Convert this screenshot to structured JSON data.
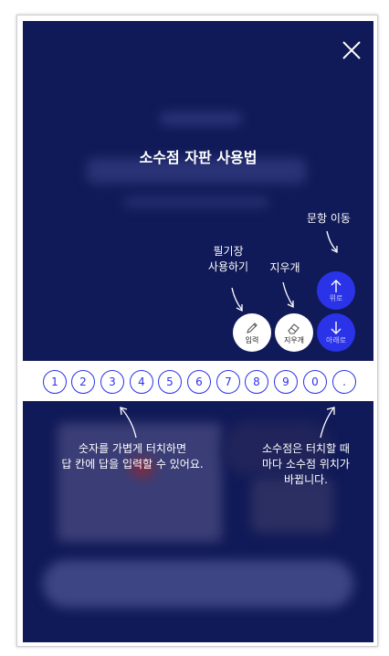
{
  "colors": {
    "background": "#111a58",
    "accent": "#2a33e8",
    "strip": "#ffffff"
  },
  "modal": {
    "title": "소수점 자판 사용법",
    "close_icon": "close-icon"
  },
  "annotations": {
    "move_question": "문항 이동",
    "notepad_line1": "필기장",
    "notepad_line2": "사용하기",
    "eraser": "지우개",
    "numbers_line1": "숫자를 가볍게 터치하면",
    "numbers_line2": "답 칸에 답을 입력할 수 있어요.",
    "decimal_line1": "소수점은 터치할 때",
    "decimal_line2": "마다 소수점 위치가",
    "decimal_line3": "바뀝니다."
  },
  "buttons": {
    "input_label": "입력",
    "eraser_label": "지우개",
    "up_label": "위로",
    "down_label": "아래로"
  },
  "keypad": {
    "keys": [
      "1",
      "2",
      "3",
      "4",
      "5",
      "6",
      "7",
      "8",
      "9",
      "0",
      "."
    ]
  }
}
